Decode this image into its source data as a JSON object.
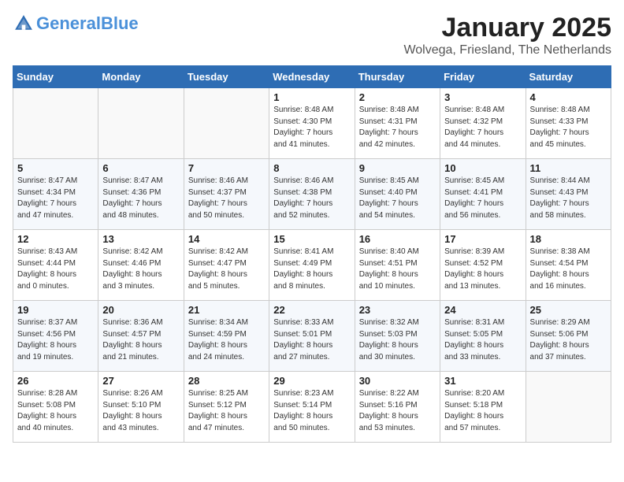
{
  "header": {
    "logo_general": "General",
    "logo_blue": "Blue",
    "month": "January 2025",
    "location": "Wolvega, Friesland, The Netherlands"
  },
  "days_of_week": [
    "Sunday",
    "Monday",
    "Tuesday",
    "Wednesday",
    "Thursday",
    "Friday",
    "Saturday"
  ],
  "weeks": [
    [
      {
        "day": "",
        "info": ""
      },
      {
        "day": "",
        "info": ""
      },
      {
        "day": "",
        "info": ""
      },
      {
        "day": "1",
        "info": "Sunrise: 8:48 AM\nSunset: 4:30 PM\nDaylight: 7 hours\nand 41 minutes."
      },
      {
        "day": "2",
        "info": "Sunrise: 8:48 AM\nSunset: 4:31 PM\nDaylight: 7 hours\nand 42 minutes."
      },
      {
        "day": "3",
        "info": "Sunrise: 8:48 AM\nSunset: 4:32 PM\nDaylight: 7 hours\nand 44 minutes."
      },
      {
        "day": "4",
        "info": "Sunrise: 8:48 AM\nSunset: 4:33 PM\nDaylight: 7 hours\nand 45 minutes."
      }
    ],
    [
      {
        "day": "5",
        "info": "Sunrise: 8:47 AM\nSunset: 4:34 PM\nDaylight: 7 hours\nand 47 minutes."
      },
      {
        "day": "6",
        "info": "Sunrise: 8:47 AM\nSunset: 4:36 PM\nDaylight: 7 hours\nand 48 minutes."
      },
      {
        "day": "7",
        "info": "Sunrise: 8:46 AM\nSunset: 4:37 PM\nDaylight: 7 hours\nand 50 minutes."
      },
      {
        "day": "8",
        "info": "Sunrise: 8:46 AM\nSunset: 4:38 PM\nDaylight: 7 hours\nand 52 minutes."
      },
      {
        "day": "9",
        "info": "Sunrise: 8:45 AM\nSunset: 4:40 PM\nDaylight: 7 hours\nand 54 minutes."
      },
      {
        "day": "10",
        "info": "Sunrise: 8:45 AM\nSunset: 4:41 PM\nDaylight: 7 hours\nand 56 minutes."
      },
      {
        "day": "11",
        "info": "Sunrise: 8:44 AM\nSunset: 4:43 PM\nDaylight: 7 hours\nand 58 minutes."
      }
    ],
    [
      {
        "day": "12",
        "info": "Sunrise: 8:43 AM\nSunset: 4:44 PM\nDaylight: 8 hours\nand 0 minutes."
      },
      {
        "day": "13",
        "info": "Sunrise: 8:42 AM\nSunset: 4:46 PM\nDaylight: 8 hours\nand 3 minutes."
      },
      {
        "day": "14",
        "info": "Sunrise: 8:42 AM\nSunset: 4:47 PM\nDaylight: 8 hours\nand 5 minutes."
      },
      {
        "day": "15",
        "info": "Sunrise: 8:41 AM\nSunset: 4:49 PM\nDaylight: 8 hours\nand 8 minutes."
      },
      {
        "day": "16",
        "info": "Sunrise: 8:40 AM\nSunset: 4:51 PM\nDaylight: 8 hours\nand 10 minutes."
      },
      {
        "day": "17",
        "info": "Sunrise: 8:39 AM\nSunset: 4:52 PM\nDaylight: 8 hours\nand 13 minutes."
      },
      {
        "day": "18",
        "info": "Sunrise: 8:38 AM\nSunset: 4:54 PM\nDaylight: 8 hours\nand 16 minutes."
      }
    ],
    [
      {
        "day": "19",
        "info": "Sunrise: 8:37 AM\nSunset: 4:56 PM\nDaylight: 8 hours\nand 19 minutes."
      },
      {
        "day": "20",
        "info": "Sunrise: 8:36 AM\nSunset: 4:57 PM\nDaylight: 8 hours\nand 21 minutes."
      },
      {
        "day": "21",
        "info": "Sunrise: 8:34 AM\nSunset: 4:59 PM\nDaylight: 8 hours\nand 24 minutes."
      },
      {
        "day": "22",
        "info": "Sunrise: 8:33 AM\nSunset: 5:01 PM\nDaylight: 8 hours\nand 27 minutes."
      },
      {
        "day": "23",
        "info": "Sunrise: 8:32 AM\nSunset: 5:03 PM\nDaylight: 8 hours\nand 30 minutes."
      },
      {
        "day": "24",
        "info": "Sunrise: 8:31 AM\nSunset: 5:05 PM\nDaylight: 8 hours\nand 33 minutes."
      },
      {
        "day": "25",
        "info": "Sunrise: 8:29 AM\nSunset: 5:06 PM\nDaylight: 8 hours\nand 37 minutes."
      }
    ],
    [
      {
        "day": "26",
        "info": "Sunrise: 8:28 AM\nSunset: 5:08 PM\nDaylight: 8 hours\nand 40 minutes."
      },
      {
        "day": "27",
        "info": "Sunrise: 8:26 AM\nSunset: 5:10 PM\nDaylight: 8 hours\nand 43 minutes."
      },
      {
        "day": "28",
        "info": "Sunrise: 8:25 AM\nSunset: 5:12 PM\nDaylight: 8 hours\nand 47 minutes."
      },
      {
        "day": "29",
        "info": "Sunrise: 8:23 AM\nSunset: 5:14 PM\nDaylight: 8 hours\nand 50 minutes."
      },
      {
        "day": "30",
        "info": "Sunrise: 8:22 AM\nSunset: 5:16 PM\nDaylight: 8 hours\nand 53 minutes."
      },
      {
        "day": "31",
        "info": "Sunrise: 8:20 AM\nSunset: 5:18 PM\nDaylight: 8 hours\nand 57 minutes."
      },
      {
        "day": "",
        "info": ""
      }
    ]
  ]
}
